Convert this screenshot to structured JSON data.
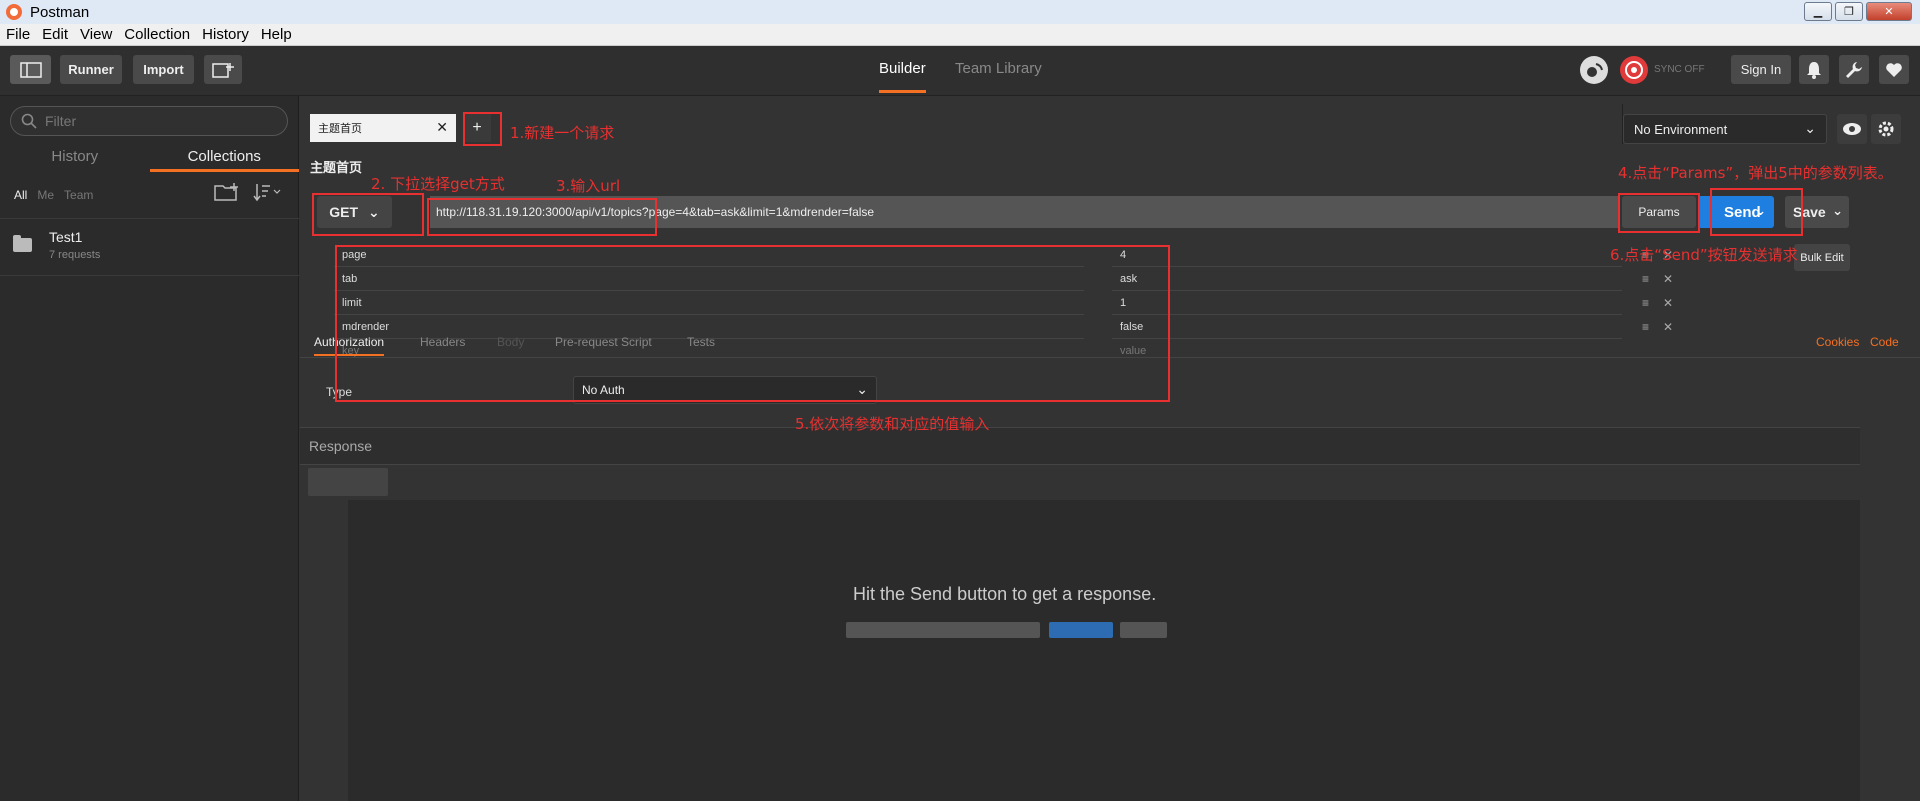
{
  "window": {
    "title": "Postman",
    "min_label": "▁",
    "max_label": "❐",
    "close_label": "✕"
  },
  "menu": [
    "File",
    "Edit",
    "View",
    "Collection",
    "History",
    "Help"
  ],
  "toolbar": {
    "runner": "Runner",
    "import": "Import",
    "builder": "Builder",
    "team_library": "Team Library",
    "sync": "SYNC OFF",
    "sign_in": "Sign In"
  },
  "sidebar": {
    "filter_placeholder": "Filter",
    "tabs": [
      "History",
      "Collections"
    ],
    "scope": [
      "All",
      "Me",
      "Team"
    ],
    "collection": {
      "name": "Test1",
      "meta": "7 requests"
    }
  },
  "request": {
    "tab_label": "主题首页",
    "new_tab": "+",
    "name": "主题首页",
    "method": "GET",
    "url": "http://118.31.19.120:3000/api/v1/topics?page=4&tab=ask&limit=1&mdrender=false",
    "params_label": "Params",
    "send_label": "Send",
    "save_label": "Save",
    "bulk_edit": "Bulk Edit",
    "params": [
      {
        "key": "page",
        "value": "4"
      },
      {
        "key": "tab",
        "value": "ask"
      },
      {
        "key": "limit",
        "value": "1"
      },
      {
        "key": "mdrender",
        "value": "false"
      }
    ],
    "param_key_placeholder": "key",
    "param_value_placeholder": "value"
  },
  "environment": {
    "selected": "No Environment"
  },
  "subtabs": [
    "Authorization",
    "Headers",
    "Body",
    "Pre-request Script",
    "Tests"
  ],
  "links": {
    "cookies": "Cookies",
    "code": "Code"
  },
  "auth": {
    "type_label": "Type",
    "type_value": "No Auth"
  },
  "response": {
    "title": "Response",
    "empty_message": "Hit the Send button to get a response."
  },
  "annotations": {
    "a1": "1.新建一个请求",
    "a2": "2. 下拉选择get方式",
    "a3": "3.输入url",
    "a4": "4.点击“Params”，弹出5中的参数列表。",
    "a5": "5.依次将参数和对应的值输入",
    "a6": "6.点击“Send”按钮发送请求"
  },
  "colors": {
    "accent": "#f47023",
    "send": "#1f7fe0",
    "annotation": "#e83030"
  }
}
